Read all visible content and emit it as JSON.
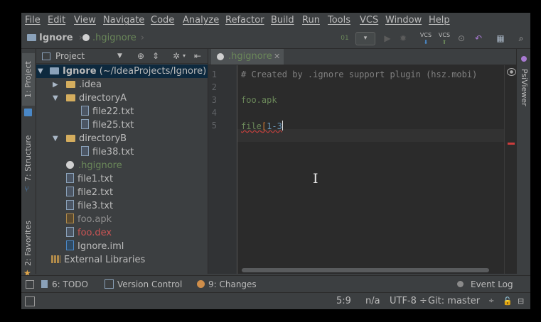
{
  "menu": [
    "File",
    "Edit",
    "View",
    "Navigate",
    "Code",
    "Analyze",
    "Refactor",
    "Build",
    "Run",
    "Tools",
    "VCS",
    "Window",
    "Help"
  ],
  "breadcrumb": {
    "project": "Ignore",
    "file": ".hgignore"
  },
  "toolbar": {
    "vcs_label_1": "VCS",
    "vcs_label_2": "VCS"
  },
  "left_tabs": {
    "project": "1: Project",
    "structure": "7: Structure",
    "favorites": "2: Favorites"
  },
  "right_tabs": {
    "psiviewer": "PsiViewer"
  },
  "project_panel": {
    "title": "Project",
    "root": {
      "name": "Ignore",
      "path": "(~/IdeaProjects/Ignore)"
    },
    "items": [
      {
        "label": ".idea"
      },
      {
        "label": "directoryA"
      },
      {
        "label": "file22.txt"
      },
      {
        "label": "file25.txt"
      },
      {
        "label": "directoryB"
      },
      {
        "label": "file38.txt"
      },
      {
        "label": ".hgignore"
      },
      {
        "label": "file1.txt"
      },
      {
        "label": "file2.txt"
      },
      {
        "label": "file3.txt"
      },
      {
        "label": "foo.apk"
      },
      {
        "label": "foo.dex"
      },
      {
        "label": "Ignore.iml"
      },
      {
        "label": "External Libraries"
      }
    ]
  },
  "editor": {
    "tab": ".hgignore",
    "line_numbers": [
      "1",
      "2",
      "3",
      "4",
      "5"
    ],
    "lines": {
      "l1": "# Created by .ignore support plugin (hsz.mobi)",
      "l3": "foo.apk",
      "l5_text": "file",
      "l5_bracket_open": "[",
      "l5_range": "1-3"
    }
  },
  "bottom_tools": {
    "todo": "6: TODO",
    "vcs": "Version Control",
    "changes": "9: Changes",
    "event_log": "Event Log"
  },
  "status": {
    "position": "5:9",
    "line_sep": "n/a",
    "encoding": "UTF-8 ÷",
    "git": "Git: master",
    "git_arrow": "÷"
  },
  "colors": {
    "accent_green": "#6a8759",
    "comment": "#808080",
    "ignored_file": "#8f8f8f",
    "deleted_file": "#cc5454",
    "hgignore_file": "#6a8759"
  }
}
